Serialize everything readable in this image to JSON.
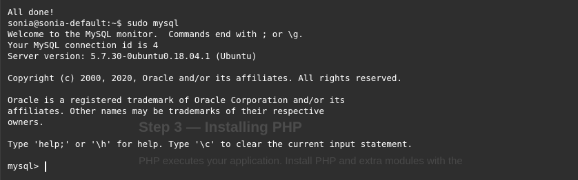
{
  "terminal": {
    "lines": [
      "All done!",
      "sonia@sonia-default:~$ sudo mysql",
      "Welcome to the MySQL monitor.  Commands end with ; or \\g.",
      "Your MySQL connection id is 4",
      "Server version: 5.7.30-0ubuntu0.18.04.1 (Ubuntu)",
      "",
      "Copyright (c) 2000, 2020, Oracle and/or its affiliates. All rights reserved.",
      "",
      "Oracle is a registered trademark of Oracle Corporation and/or its",
      "affiliates. Other names may be trademarks of their respective",
      "owners.",
      "",
      "Type 'help;' or '\\h' for help. Type '\\c' to clear the current input statement.",
      ""
    ],
    "prompt": "mysql> "
  },
  "background_page": {
    "heading": "Step 3 — Installing PHP",
    "body": "PHP executes your application. Install PHP and extra modules with the"
  },
  "colors": {
    "background": "#2e2e2e",
    "text": "#ffffff"
  }
}
